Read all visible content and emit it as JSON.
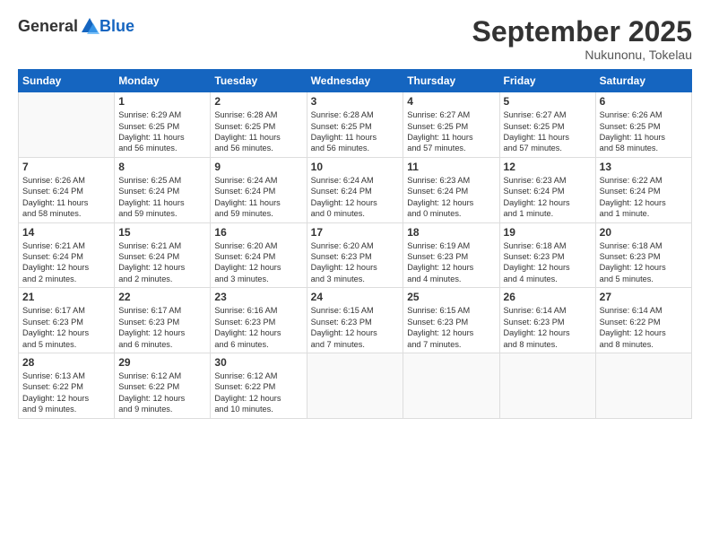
{
  "logo": {
    "general": "General",
    "blue": "Blue"
  },
  "title": "September 2025",
  "location": "Nukunonu, Tokelau",
  "days_header": [
    "Sunday",
    "Monday",
    "Tuesday",
    "Wednesday",
    "Thursday",
    "Friday",
    "Saturday"
  ],
  "weeks": [
    [
      {
        "day": "",
        "info": ""
      },
      {
        "day": "1",
        "info": "Sunrise: 6:29 AM\nSunset: 6:25 PM\nDaylight: 11 hours\nand 56 minutes."
      },
      {
        "day": "2",
        "info": "Sunrise: 6:28 AM\nSunset: 6:25 PM\nDaylight: 11 hours\nand 56 minutes."
      },
      {
        "day": "3",
        "info": "Sunrise: 6:28 AM\nSunset: 6:25 PM\nDaylight: 11 hours\nand 56 minutes."
      },
      {
        "day": "4",
        "info": "Sunrise: 6:27 AM\nSunset: 6:25 PM\nDaylight: 11 hours\nand 57 minutes."
      },
      {
        "day": "5",
        "info": "Sunrise: 6:27 AM\nSunset: 6:25 PM\nDaylight: 11 hours\nand 57 minutes."
      },
      {
        "day": "6",
        "info": "Sunrise: 6:26 AM\nSunset: 6:25 PM\nDaylight: 11 hours\nand 58 minutes."
      }
    ],
    [
      {
        "day": "7",
        "info": "Sunrise: 6:26 AM\nSunset: 6:24 PM\nDaylight: 11 hours\nand 58 minutes."
      },
      {
        "day": "8",
        "info": "Sunrise: 6:25 AM\nSunset: 6:24 PM\nDaylight: 11 hours\nand 59 minutes."
      },
      {
        "day": "9",
        "info": "Sunrise: 6:24 AM\nSunset: 6:24 PM\nDaylight: 11 hours\nand 59 minutes."
      },
      {
        "day": "10",
        "info": "Sunrise: 6:24 AM\nSunset: 6:24 PM\nDaylight: 12 hours\nand 0 minutes."
      },
      {
        "day": "11",
        "info": "Sunrise: 6:23 AM\nSunset: 6:24 PM\nDaylight: 12 hours\nand 0 minutes."
      },
      {
        "day": "12",
        "info": "Sunrise: 6:23 AM\nSunset: 6:24 PM\nDaylight: 12 hours\nand 1 minute."
      },
      {
        "day": "13",
        "info": "Sunrise: 6:22 AM\nSunset: 6:24 PM\nDaylight: 12 hours\nand 1 minute."
      }
    ],
    [
      {
        "day": "14",
        "info": "Sunrise: 6:21 AM\nSunset: 6:24 PM\nDaylight: 12 hours\nand 2 minutes."
      },
      {
        "day": "15",
        "info": "Sunrise: 6:21 AM\nSunset: 6:24 PM\nDaylight: 12 hours\nand 2 minutes."
      },
      {
        "day": "16",
        "info": "Sunrise: 6:20 AM\nSunset: 6:24 PM\nDaylight: 12 hours\nand 3 minutes."
      },
      {
        "day": "17",
        "info": "Sunrise: 6:20 AM\nSunset: 6:23 PM\nDaylight: 12 hours\nand 3 minutes."
      },
      {
        "day": "18",
        "info": "Sunrise: 6:19 AM\nSunset: 6:23 PM\nDaylight: 12 hours\nand 4 minutes."
      },
      {
        "day": "19",
        "info": "Sunrise: 6:18 AM\nSunset: 6:23 PM\nDaylight: 12 hours\nand 4 minutes."
      },
      {
        "day": "20",
        "info": "Sunrise: 6:18 AM\nSunset: 6:23 PM\nDaylight: 12 hours\nand 5 minutes."
      }
    ],
    [
      {
        "day": "21",
        "info": "Sunrise: 6:17 AM\nSunset: 6:23 PM\nDaylight: 12 hours\nand 5 minutes."
      },
      {
        "day": "22",
        "info": "Sunrise: 6:17 AM\nSunset: 6:23 PM\nDaylight: 12 hours\nand 6 minutes."
      },
      {
        "day": "23",
        "info": "Sunrise: 6:16 AM\nSunset: 6:23 PM\nDaylight: 12 hours\nand 6 minutes."
      },
      {
        "day": "24",
        "info": "Sunrise: 6:15 AM\nSunset: 6:23 PM\nDaylight: 12 hours\nand 7 minutes."
      },
      {
        "day": "25",
        "info": "Sunrise: 6:15 AM\nSunset: 6:23 PM\nDaylight: 12 hours\nand 7 minutes."
      },
      {
        "day": "26",
        "info": "Sunrise: 6:14 AM\nSunset: 6:23 PM\nDaylight: 12 hours\nand 8 minutes."
      },
      {
        "day": "27",
        "info": "Sunrise: 6:14 AM\nSunset: 6:22 PM\nDaylight: 12 hours\nand 8 minutes."
      }
    ],
    [
      {
        "day": "28",
        "info": "Sunrise: 6:13 AM\nSunset: 6:22 PM\nDaylight: 12 hours\nand 9 minutes."
      },
      {
        "day": "29",
        "info": "Sunrise: 6:12 AM\nSunset: 6:22 PM\nDaylight: 12 hours\nand 9 minutes."
      },
      {
        "day": "30",
        "info": "Sunrise: 6:12 AM\nSunset: 6:22 PM\nDaylight: 12 hours\nand 10 minutes."
      },
      {
        "day": "",
        "info": ""
      },
      {
        "day": "",
        "info": ""
      },
      {
        "day": "",
        "info": ""
      },
      {
        "day": "",
        "info": ""
      }
    ]
  ]
}
